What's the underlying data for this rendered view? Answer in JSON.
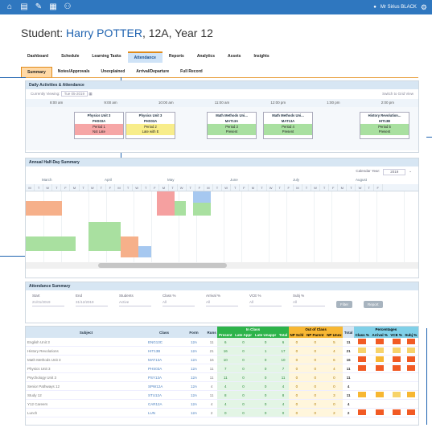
{
  "topbar": {
    "user": "Mr Sirius BLACK",
    "icons": [
      "home-icon",
      "list-icon",
      "pencil-icon",
      "grid-icon",
      "people-icon"
    ]
  },
  "header": {
    "prefix": "Student:",
    "name": "Harry POTTER",
    "suffix": ", 12A, Year 12"
  },
  "tabs": [
    "Dashboard",
    "Schedule",
    "Learning Tasks",
    "Attendance",
    "Reports",
    "Analytics",
    "Assets",
    "Insights"
  ],
  "subtabs": [
    "Summary",
    "Notes/Approvals",
    "Unexplained",
    "Arrival/Departure",
    "Full Record"
  ],
  "daily": {
    "title": "Daily Activities & Attendance",
    "viewing_label": "Currently Viewing:",
    "date": "Tue 05-2019",
    "switch": "Switch to Grid View",
    "times": [
      "8:00 am",
      "9:00 am",
      "10:00 am",
      "11:00 am",
      "12:00 pm",
      "1:00 pm",
      "2:00 pm"
    ],
    "classes": [
      {
        "title": "Physics Unit 3",
        "code": "PHS03A",
        "status": "Period 1",
        "detail": "Not Late",
        "color": "#f6a6a6"
      },
      {
        "title": "Physics Unit 3",
        "code": "PHS03A",
        "status": "Period 2",
        "detail": "Late with E",
        "color": "#f8ed8a"
      },
      {
        "title": "Math Methods Uni...",
        "code": "MAT13A",
        "status": "Period 3",
        "detail": "Present",
        "color": "#a9e0a0"
      },
      {
        "title": "Math Methods Uni...",
        "code": "MAT13A",
        "status": "Period 4",
        "detail": "Present",
        "color": "#a9e0a0"
      },
      {
        "title": "History Revolution...",
        "code": "HIT13B",
        "status": "Period 5",
        "detail": "Present",
        "color": "#a9e0a0"
      }
    ]
  },
  "halfday": {
    "title": "Annual Half-Day Summary",
    "calendar_label": "Calendar Year:",
    "year": "2019",
    "months": [
      "March",
      "April",
      "May",
      "June",
      "July",
      "August"
    ],
    "days": [
      "M",
      "T",
      "W",
      "T",
      "F",
      "M",
      "T",
      "W",
      "T",
      "F",
      "M",
      "T",
      "W",
      "T",
      "F",
      "M",
      "T",
      "W",
      "T",
      "F",
      "M",
      "T",
      "W",
      "T",
      "F",
      "M",
      "T",
      "W",
      "T",
      "F",
      "M",
      "T",
      "W",
      "T",
      "F",
      "M",
      "T",
      "W",
      "T",
      "F"
    ]
  },
  "attendance_summary": {
    "title": "Attendance Summary",
    "fields": [
      {
        "label": "Start",
        "value": "21/01/2019"
      },
      {
        "label": "End",
        "value": "31/12/2019"
      },
      {
        "label": "Students",
        "value": "Active"
      },
      {
        "label": "Class %",
        "value": "All"
      },
      {
        "label": "Arrival %",
        "value": "All"
      },
      {
        "label": "VCE %",
        "value": "All"
      },
      {
        "label": "Subj %",
        "value": "All"
      }
    ],
    "filter_btn": "Filter",
    "report_btn": "Report"
  },
  "table": {
    "headers": {
      "subject": "Subject",
      "class": "Class",
      "form": "Form",
      "runs": "Runs",
      "in_class": "In Class",
      "out_class": "Out of Class",
      "total": "Total",
      "percentages": "Percentages"
    },
    "sub_in": [
      "Present",
      "Late Appr",
      "Late Unappr",
      "Total"
    ],
    "sub_out": [
      "NP Schl",
      "NP Parent",
      "NP Unex"
    ],
    "sub_pct": [
      "Class %",
      "Arrival %",
      "VCE %",
      "Subj %"
    ],
    "rows": [
      {
        "subject": "English Unit 3",
        "class": "ENG13C",
        "form": "12A",
        "runs": "11",
        "a": "6",
        "b": "0",
        "c": "0",
        "d": "6",
        "e": "0",
        "f": "0",
        "g": "5",
        "t": "11"
      },
      {
        "subject": "History Revolutions",
        "class": "HIT13B",
        "form": "12A",
        "runs": "21",
        "a": "16",
        "b": "0",
        "c": "1",
        "d": "17",
        "e": "0",
        "f": "0",
        "g": "4",
        "t": "21"
      },
      {
        "subject": "Math Methods Unit 3",
        "class": "MAT13A",
        "form": "12A",
        "runs": "16",
        "a": "10",
        "b": "0",
        "c": "0",
        "d": "10",
        "e": "0",
        "f": "0",
        "g": "6",
        "t": "16"
      },
      {
        "subject": "Physics Unit 3",
        "class": "PHS03A",
        "form": "12A",
        "runs": "11",
        "a": "7",
        "b": "0",
        "c": "0",
        "d": "7",
        "e": "0",
        "f": "0",
        "g": "4",
        "t": "11"
      },
      {
        "subject": "Psychology Unit 3",
        "class": "PSY13A",
        "form": "12A",
        "runs": "11",
        "a": "11",
        "b": "0",
        "c": "0",
        "d": "11",
        "e": "0",
        "f": "0",
        "g": "0",
        "t": "11"
      },
      {
        "subject": "Senior Pathways 12",
        "class": "SPW12A",
        "form": "12A",
        "runs": "4",
        "a": "4",
        "b": "0",
        "c": "0",
        "d": "4",
        "e": "0",
        "f": "0",
        "g": "0",
        "t": "4"
      },
      {
        "subject": "Study 12",
        "class": "STU12A",
        "form": "12A",
        "runs": "11",
        "a": "8",
        "b": "0",
        "c": "0",
        "d": "8",
        "e": "0",
        "f": "0",
        "g": "3",
        "t": "11"
      },
      {
        "subject": "Y12 Careers",
        "class": "CAR12A",
        "form": "12A",
        "runs": "4",
        "a": "4",
        "b": "0",
        "c": "0",
        "d": "4",
        "e": "0",
        "f": "0",
        "g": "0",
        "t": "4"
      },
      {
        "subject": "Lunch",
        "class": "LUN",
        "form": "12A",
        "runs": "2",
        "a": "0",
        "b": "0",
        "c": "0",
        "d": "0",
        "e": "0",
        "f": "0",
        "g": "2",
        "t": "2"
      }
    ],
    "pct_colors": [
      [
        "#f15a24",
        "#f15a24",
        "#f15a24",
        "#f15a24"
      ],
      [
        "#f7d36b",
        "#f7d36b",
        "#f7d36b",
        "#f7d36b"
      ],
      [
        "#f15a24",
        "#f7b733",
        "#f15a24",
        "#f15a24"
      ],
      [
        "#f15a24",
        "#f15a24",
        "#f15a24",
        "#f15a24"
      ],
      [
        "#ffffff",
        "#ffffff",
        "#ffffff",
        "#ffffff"
      ],
      [
        "#ffffff",
        "#ffffff",
        "#ffffff",
        "#ffffff"
      ],
      [
        "#f7b733",
        "#f7b733",
        "#f7d36b",
        "#f7b733"
      ],
      [
        "#ffffff",
        "#ffffff",
        "#ffffff",
        "#ffffff"
      ],
      [
        "#f15a24",
        "#f15a24",
        "#f15a24",
        "#f15a24"
      ]
    ]
  }
}
